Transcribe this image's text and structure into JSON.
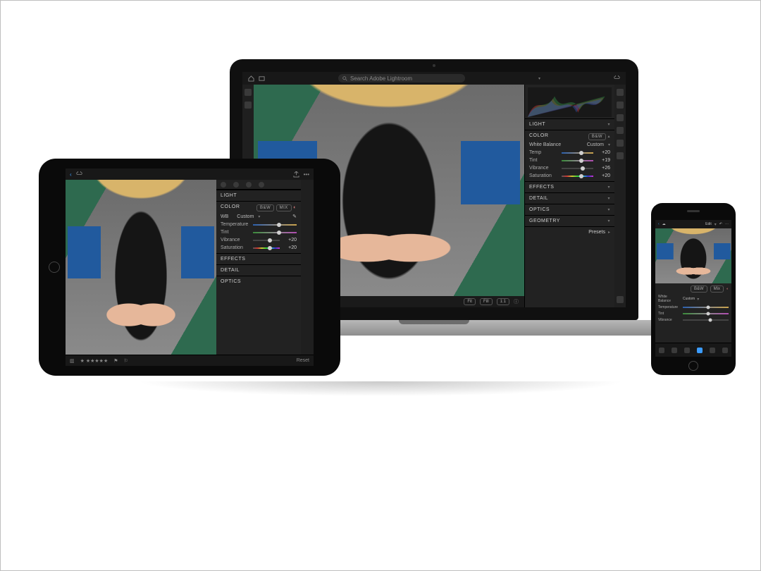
{
  "app": {
    "search_placeholder": "Search Adobe Lightroom"
  },
  "laptop": {
    "sections": {
      "light": "Light",
      "color": "Color",
      "effects": "Effects",
      "detail": "Detail",
      "optics": "Optics",
      "geometry": "Geometry"
    },
    "color": {
      "bw_pill": "B&W",
      "wb_label": "White Balance",
      "wb_value": "Custom",
      "temp": {
        "label": "Temp",
        "value": "+20",
        "pos": 63
      },
      "tint": {
        "label": "Tint",
        "value": "+19",
        "pos": 62
      },
      "vibrance": {
        "label": "Vibrance",
        "value": "+26",
        "pos": 66
      },
      "saturation": {
        "label": "Saturation",
        "value": "+20",
        "pos": 63
      }
    },
    "footer": {
      "fit": "Fit",
      "fill": "Fill",
      "ratio": "1:1",
      "presets": "Presets",
      "flag_on": "⚑",
      "flag_off": "⚐",
      "stars": "★★★★★"
    }
  },
  "tablet": {
    "sections": {
      "light": "Light",
      "color": "Color",
      "effects": "Effects",
      "detail": "Detail",
      "optics": "Optics"
    },
    "color": {
      "bw_pill": "B&W",
      "mix_pill": "Mix",
      "wb_label": "WB",
      "wb_value": "Custom",
      "temp": {
        "label": "Temperature",
        "value": "",
        "pos": 60
      },
      "tint": {
        "label": "Tint",
        "value": "",
        "pos": 60
      },
      "vibrance": {
        "label": "Vibrance",
        "value": "+20",
        "pos": 62
      },
      "saturation": {
        "label": "Saturation",
        "value": "+20",
        "pos": 62
      }
    },
    "footer": {
      "stars": "★ ★★★★★",
      "flag_on": "⚑",
      "flag_off": "⚐",
      "reset": "Reset"
    }
  },
  "phone": {
    "top": {
      "edit": "Edit"
    },
    "color": {
      "bw_pill": "B&W",
      "mix_pill": "Mix",
      "wb_label": "White Balance",
      "wb_value": "Custom",
      "temp": {
        "label": "Temperature",
        "pos": 55
      },
      "tint": {
        "label": "Tint",
        "pos": 55
      },
      "vibrance": {
        "label": "Vibrance",
        "pos": 60
      }
    },
    "tools": {
      "crop": "Crop",
      "presets": "Presets",
      "light": "Light",
      "color": "Color",
      "effects": "Effects"
    }
  }
}
